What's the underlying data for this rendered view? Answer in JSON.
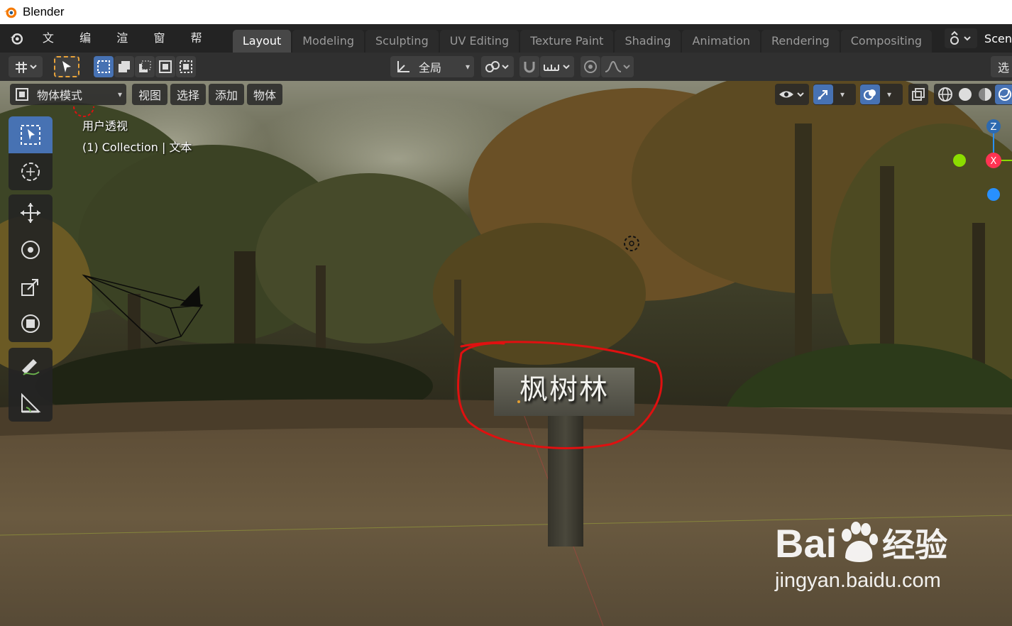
{
  "window": {
    "title": "Blender"
  },
  "menu": [
    "文件",
    "编辑",
    "渲染",
    "窗口",
    "帮助"
  ],
  "workspaces": [
    {
      "label": "Layout",
      "active": true
    },
    {
      "label": "Modeling",
      "active": false
    },
    {
      "label": "Sculpting",
      "active": false
    },
    {
      "label": "UV Editing",
      "active": false
    },
    {
      "label": "Texture Paint",
      "active": false
    },
    {
      "label": "Shading",
      "active": false
    },
    {
      "label": "Animation",
      "active": false
    },
    {
      "label": "Rendering",
      "active": false
    },
    {
      "label": "Compositing",
      "active": false
    }
  ],
  "scene_label": "Scen",
  "tool_header": {
    "transform_orientation": "全局",
    "select_truncated": "选"
  },
  "viewport_header": {
    "mode": "物体模式",
    "menus": [
      "视图",
      "选择",
      "添加",
      "物体"
    ]
  },
  "viewport_info": {
    "view_name": "用户透视",
    "collection": "(1) Collection | 文本"
  },
  "axes": {
    "z": "Z",
    "x": "X"
  },
  "sign_text": "枫树林",
  "watermark": {
    "brand": "Bai",
    "brand_cn": "经验",
    "url": "jingyan.baidu.com"
  },
  "colors": {
    "accent_blue": "#4772b3",
    "annotation_red": "#e01010",
    "axis_x": "#ff3352",
    "axis_y": "#8bdc00",
    "axis_z": "#2890ff"
  }
}
